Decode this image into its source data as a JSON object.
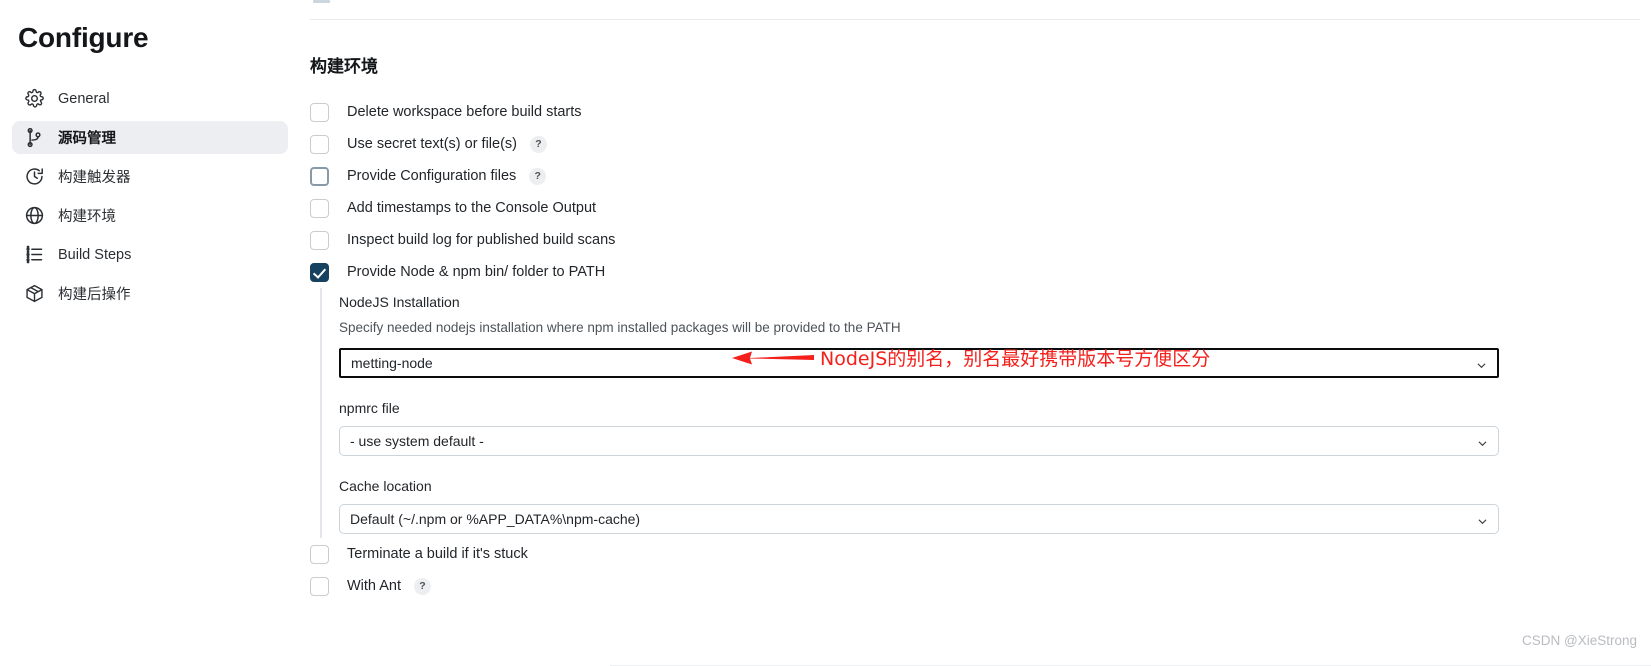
{
  "sidebar": {
    "title": "Configure",
    "items": [
      {
        "label": "General",
        "icon": "gear-icon",
        "active": false,
        "cjk": false
      },
      {
        "label": "源码管理",
        "icon": "git-branch-icon",
        "active": true,
        "cjk": true
      },
      {
        "label": "构建触发器",
        "icon": "clock-icon",
        "active": false,
        "cjk": true
      },
      {
        "label": "构建环境",
        "icon": "globe-icon",
        "active": false,
        "cjk": true
      },
      {
        "label": "Build Steps",
        "icon": "list-icon",
        "active": false,
        "cjk": false
      },
      {
        "label": "构建后操作",
        "icon": "package-icon",
        "active": false,
        "cjk": true
      }
    ]
  },
  "main": {
    "section_title": "构建环境",
    "checkboxes_top": [
      {
        "label": "Delete workspace before build starts",
        "checked": false,
        "hover": false,
        "help": false
      },
      {
        "label": "Use secret text(s) or file(s)",
        "checked": false,
        "hover": false,
        "help": true,
        "help_label": "?"
      },
      {
        "label": "Provide Configuration files",
        "checked": false,
        "hover": true,
        "help": true,
        "help_label": "?"
      },
      {
        "label": "Add timestamps to the Console Output",
        "checked": false,
        "hover": false,
        "help": false
      },
      {
        "label": "Inspect build log for published build scans",
        "checked": false,
        "hover": false,
        "help": false
      },
      {
        "label": "Provide Node & npm bin/ folder to PATH",
        "checked": true,
        "hover": false,
        "help": false
      }
    ],
    "nodejs": {
      "installation_label": "NodeJS Installation",
      "installation_desc": "Specify needed nodejs installation where npm installed packages will be provided to the PATH",
      "installation_value": "metting-node",
      "npmrc_label": "npmrc file",
      "npmrc_value": "- use system default -",
      "cache_label": "Cache location",
      "cache_value": "Default (~/.npm or %APP_DATA%\\npm-cache)"
    },
    "checkboxes_bottom": [
      {
        "label": "Terminate a build if it's stuck",
        "checked": false,
        "hover": false,
        "help": false
      },
      {
        "label": "With Ant",
        "checked": false,
        "hover": false,
        "help": true,
        "help_label": "?"
      }
    ]
  },
  "annotation": {
    "text": "NodeJS的别名，别名最好携带版本号方便区分",
    "color": "#f4201c"
  },
  "watermark": {
    "text": "CSDN @XieStrong"
  }
}
